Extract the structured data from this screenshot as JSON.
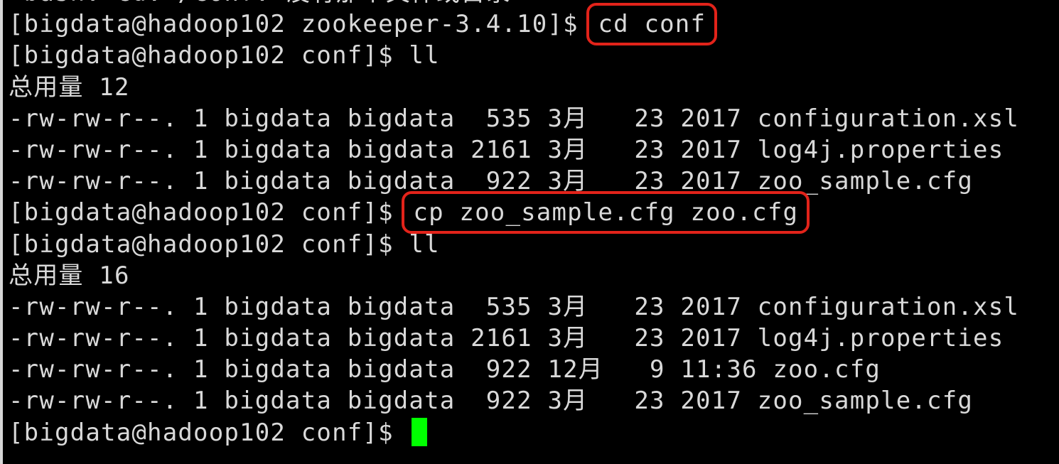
{
  "terminal": {
    "colors": {
      "background": "#000000",
      "foreground": "#d9d9d9",
      "highlight_box": "#e2231a",
      "cursor": "#00ff00"
    },
    "lines": [
      {
        "kind": "output",
        "text": "-bash: cd: /conf: 没有那个文件或目录"
      },
      {
        "kind": "prompt",
        "prompt": "[bigdata@hadoop102 zookeeper-3.4.10]$ ",
        "command": "cd conf",
        "highlight": true
      },
      {
        "kind": "prompt",
        "prompt": "[bigdata@hadoop102 conf]$ ",
        "command": "ll",
        "highlight": false
      },
      {
        "kind": "output",
        "text": "总用量 12"
      },
      {
        "kind": "output",
        "text": "-rw-rw-r--. 1 bigdata bigdata  535 3月   23 2017 configuration.xsl"
      },
      {
        "kind": "output",
        "text": "-rw-rw-r--. 1 bigdata bigdata 2161 3月   23 2017 log4j.properties"
      },
      {
        "kind": "output",
        "text": "-rw-rw-r--. 1 bigdata bigdata  922 3月   23 2017 zoo_sample.cfg"
      },
      {
        "kind": "prompt",
        "prompt": "[bigdata@hadoop102 conf]$ ",
        "command": "cp zoo_sample.cfg zoo.cfg",
        "highlight": true
      },
      {
        "kind": "prompt",
        "prompt": "[bigdata@hadoop102 conf]$ ",
        "command": "ll",
        "highlight": false
      },
      {
        "kind": "output",
        "text": "总用量 16"
      },
      {
        "kind": "output",
        "text": "-rw-rw-r--. 1 bigdata bigdata  535 3月   23 2017 configuration.xsl"
      },
      {
        "kind": "output",
        "text": "-rw-rw-r--. 1 bigdata bigdata 2161 3月   23 2017 log4j.properties"
      },
      {
        "kind": "output",
        "text": "-rw-rw-r--. 1 bigdata bigdata  922 12月   9 11:36 zoo.cfg"
      },
      {
        "kind": "output",
        "text": "-rw-rw-r--. 1 bigdata bigdata  922 3月   23 2017 zoo_sample.cfg"
      },
      {
        "kind": "prompt",
        "prompt": "[bigdata@hadoop102 conf]$ ",
        "command": "",
        "highlight": false,
        "cursor": true
      }
    ]
  }
}
